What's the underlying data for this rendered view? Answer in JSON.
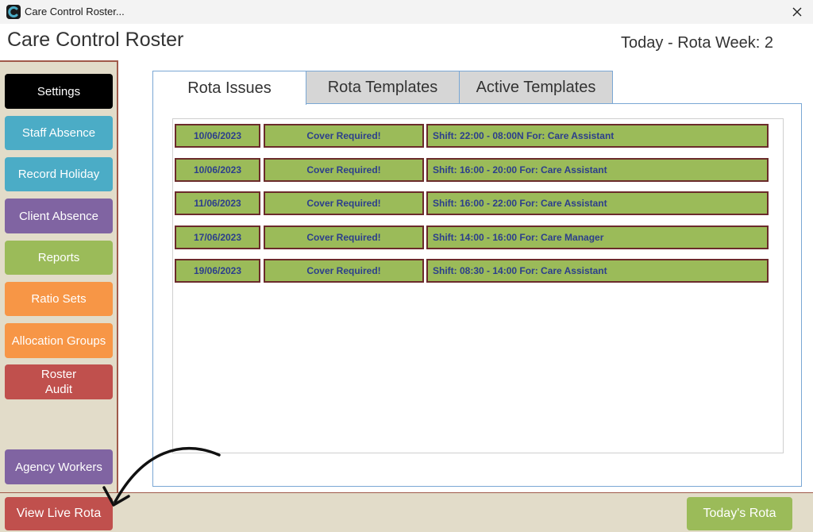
{
  "window": {
    "title": "Care Control Roster...",
    "close_symbol": "✕"
  },
  "header": {
    "app_title": "Care Control Roster",
    "rota_week": "Today - Rota Week: 2"
  },
  "sidebar": {
    "items": [
      {
        "label": "Settings",
        "color": "#000000"
      },
      {
        "label": "Staff Absence",
        "color": "#4bacc6"
      },
      {
        "label": "Record Holiday",
        "color": "#4bacc6"
      },
      {
        "label": "Client Absence",
        "color": "#8064a2"
      },
      {
        "label": "Reports",
        "color": "#9bbb59"
      },
      {
        "label": "Ratio Sets",
        "color": "#f79646"
      },
      {
        "label": "Allocation Groups",
        "color": "#f79646"
      },
      {
        "label_line1": "Roster",
        "label_line2": "Audit",
        "color": "#c0504d"
      },
      {
        "label": "Agency Workers",
        "color": "#8064a2"
      }
    ]
  },
  "tabs": [
    {
      "label": "Rota Issues",
      "active": true
    },
    {
      "label": "Rota Templates",
      "active": false
    },
    {
      "label": "Active Templates",
      "active": false
    }
  ],
  "issues": [
    {
      "date": "10/06/2023",
      "status": "Cover Required!",
      "detail": "Shift: 22:00 - 08:00N For: Care Assistant"
    },
    {
      "date": "10/06/2023",
      "status": "Cover Required!",
      "detail": "Shift: 16:00 - 20:00 For: Care Assistant"
    },
    {
      "date": "11/06/2023",
      "status": "Cover Required!",
      "detail": "Shift: 16:00 - 22:00 For: Care Assistant"
    },
    {
      "date": "17/06/2023",
      "status": "Cover Required!",
      "detail": "Shift: 14:00 - 16:00 For: Care Manager"
    },
    {
      "date": "19/06/2023",
      "status": "Cover Required!",
      "detail": "Shift: 08:30 - 14:00 For: Care Assistant"
    }
  ],
  "bottom": {
    "view_live_rota": {
      "label": "View Live Rota",
      "color": "#c0504d"
    },
    "todays_rota": {
      "label": "Today's Rota",
      "color": "#9bbb59"
    }
  },
  "colors": {
    "issue_cell_bg": "#9bbb59",
    "issue_cell_border": "#6b2b2b",
    "issue_text": "#2c3e8c",
    "sidebar_bg": "#e2dcc9",
    "panel_border": "#7aa7d4"
  },
  "icons": {
    "app": "care-control-c-icon",
    "close": "close-icon",
    "annotation": "curved-arrow-icon"
  }
}
